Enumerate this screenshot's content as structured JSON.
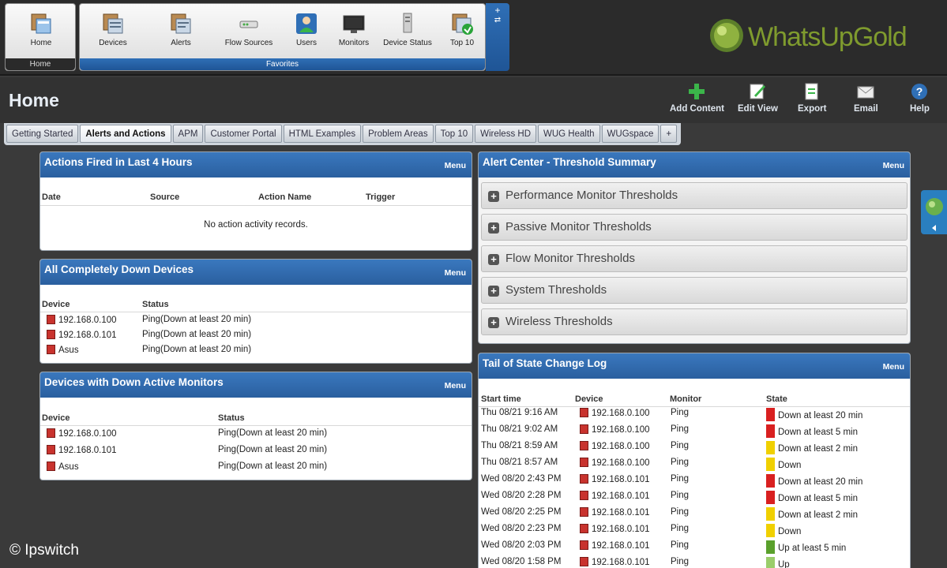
{
  "ribbon": {
    "home_group": {
      "title": "Home",
      "items": [
        {
          "label": "Home",
          "icon": "home-icon"
        }
      ]
    },
    "favorites_group": {
      "title": "Favorites",
      "items": [
        {
          "label": "Devices",
          "icon": "devices-icon"
        },
        {
          "label": "Alerts",
          "icon": "alerts-icon"
        },
        {
          "label": "Flow Sources",
          "icon": "flow-sources-icon"
        },
        {
          "label": "Users",
          "icon": "users-icon"
        },
        {
          "label": "Monitors",
          "icon": "monitors-icon"
        },
        {
          "label": "Device Status",
          "icon": "device-status-icon"
        },
        {
          "label": "Top 10",
          "icon": "top10-icon"
        }
      ]
    },
    "side_plus": "+",
    "side_swap": "⇄"
  },
  "logo": {
    "text": "WhatsUpGold"
  },
  "page": {
    "title": "Home"
  },
  "toolbar": {
    "add_content": "Add Content",
    "edit_view": "Edit View",
    "export": "Export",
    "email": "Email",
    "help": "Help"
  },
  "tabs": [
    {
      "label": "Getting Started",
      "active": false
    },
    {
      "label": "Alerts and Actions",
      "active": true
    },
    {
      "label": "APM",
      "active": false
    },
    {
      "label": "Customer Portal",
      "active": false
    },
    {
      "label": "HTML Examples",
      "active": false
    },
    {
      "label": "Problem Areas",
      "active": false
    },
    {
      "label": "Top 10",
      "active": false
    },
    {
      "label": "Wireless HD",
      "active": false
    },
    {
      "label": "WUG Health",
      "active": false
    },
    {
      "label": "WUGspace",
      "active": false
    },
    {
      "label": "+",
      "active": false
    }
  ],
  "actions_panel": {
    "title": "Actions Fired in Last 4 Hours",
    "menu": "Menu",
    "columns": [
      "Date",
      "Source",
      "Action Name",
      "Trigger"
    ],
    "empty_text": "No action activity records."
  },
  "down_devices_panel": {
    "title": "All Completely Down Devices",
    "menu": "Menu",
    "columns": [
      "Device",
      "Status"
    ],
    "rows": [
      {
        "device": "192.168.0.100",
        "status": "Ping(Down at least 20 min)"
      },
      {
        "device": "192.168.0.101",
        "status": "Ping(Down at least 20 min)"
      },
      {
        "device": "Asus",
        "status": "Ping(Down at least 20 min)"
      }
    ]
  },
  "down_monitors_panel": {
    "title": "Devices with Down Active Monitors",
    "menu": "Menu",
    "columns": [
      "Device",
      "Status"
    ],
    "rows": [
      {
        "device": "192.168.0.100",
        "status": "Ping(Down at least 20 min)"
      },
      {
        "device": "192.168.0.101",
        "status": "Ping(Down at least 20 min)"
      },
      {
        "device": "Asus",
        "status": "Ping(Down at least 20 min)"
      }
    ]
  },
  "threshold_panel": {
    "title": "Alert Center - Threshold Summary",
    "menu": "Menu",
    "items": [
      "Performance Monitor Thresholds",
      "Passive Monitor Thresholds",
      "Flow Monitor Thresholds",
      "System Thresholds",
      "Wireless Thresholds"
    ]
  },
  "state_log_panel": {
    "title": "Tail of State Change Log",
    "menu": "Menu",
    "columns": [
      "Start time",
      "Device",
      "Monitor",
      "State"
    ],
    "rows": [
      {
        "time": "Thu 08/21 9:16 AM",
        "device": "192.168.0.100",
        "monitor": "Ping",
        "state": "Down at least 20 min",
        "color": "#d92020"
      },
      {
        "time": "Thu 08/21 9:02 AM",
        "device": "192.168.0.100",
        "monitor": "Ping",
        "state": "Down at least 5 min",
        "color": "#d92020"
      },
      {
        "time": "Thu 08/21 8:59 AM",
        "device": "192.168.0.100",
        "monitor": "Ping",
        "state": "Down at least 2 min",
        "color": "#f0d000"
      },
      {
        "time": "Thu 08/21 8:57 AM",
        "device": "192.168.0.100",
        "monitor": "Ping",
        "state": "Down",
        "color": "#f0d000"
      },
      {
        "time": "Wed 08/20 2:43 PM",
        "device": "192.168.0.101",
        "monitor": "Ping",
        "state": "Down at least 20 min",
        "color": "#d92020"
      },
      {
        "time": "Wed 08/20 2:28 PM",
        "device": "192.168.0.101",
        "monitor": "Ping",
        "state": "Down at least 5 min",
        "color": "#d92020"
      },
      {
        "time": "Wed 08/20 2:25 PM",
        "device": "192.168.0.101",
        "monitor": "Ping",
        "state": "Down at least 2 min",
        "color": "#f0d000"
      },
      {
        "time": "Wed 08/20 2:23 PM",
        "device": "192.168.0.101",
        "monitor": "Ping",
        "state": "Down",
        "color": "#f0d000"
      },
      {
        "time": "Wed 08/20 2:03 PM",
        "device": "192.168.0.101",
        "monitor": "Ping",
        "state": "Up at least 5 min",
        "color": "#5aa02c"
      },
      {
        "time": "Wed 08/20 1:58 PM",
        "device": "192.168.0.101",
        "monitor": "Ping",
        "state": "Up",
        "color": "#9acd6a"
      }
    ]
  },
  "footer": {
    "copyright": "© Ipswitch"
  }
}
